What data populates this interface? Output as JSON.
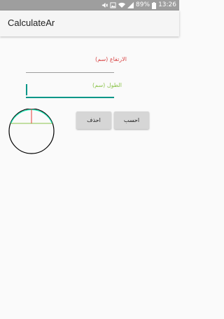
{
  "status_bar": {
    "battery": "89%",
    "time": "13:26",
    "icons": [
      "mute-icon",
      "image-icon",
      "wifi-icon",
      "signal-icon",
      "battery-icon"
    ]
  },
  "app_bar": {
    "title": "CalculateAr"
  },
  "form": {
    "height_label": "الارتفاع (سم)",
    "height_value": "",
    "length_label": "الطول (سم)",
    "length_value": ""
  },
  "buttons": {
    "delete_label": "احذف",
    "calculate_label": "احسب"
  },
  "colors": {
    "height_label": "#d84343",
    "length_label": "#8bc34a",
    "accent": "#009688",
    "arc": "#1de9b6",
    "chord": "#8bc34a",
    "height_line": "#e53935",
    "circle": "#000000"
  }
}
